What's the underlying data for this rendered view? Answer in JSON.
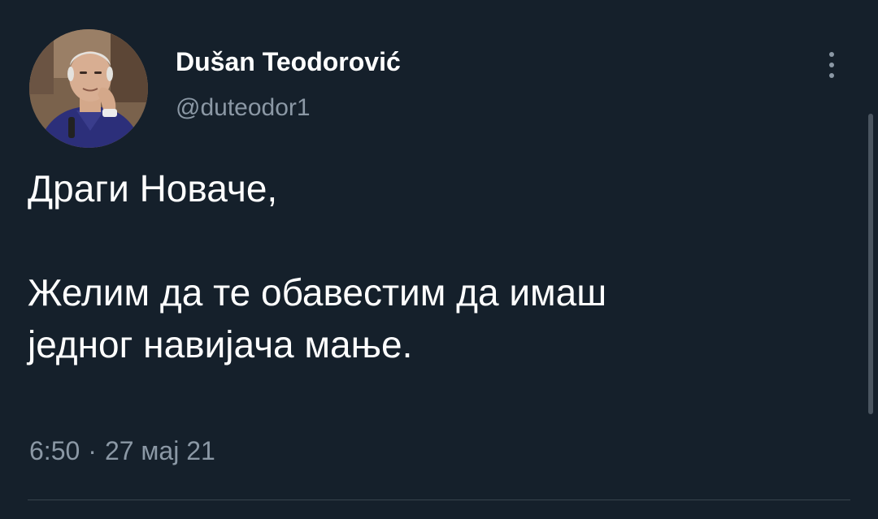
{
  "tweet": {
    "author": {
      "display_name": "Dušan Teodorović",
      "handle": "@duteodor1",
      "avatar_icon": "profile-photo"
    },
    "text_lines": [
      "Драги Новаче,",
      "Желим да те обавестим да имаш",
      "једног навијача мање."
    ],
    "time": "6:50",
    "separator": "·",
    "date": "27 мај 21"
  },
  "icons": {
    "more_options": "vertical-ellipsis-icon"
  },
  "colors": {
    "background": "#15202b",
    "primary_text": "#ffffff",
    "secondary_text": "#8b98a5",
    "divider": "#38444d"
  }
}
